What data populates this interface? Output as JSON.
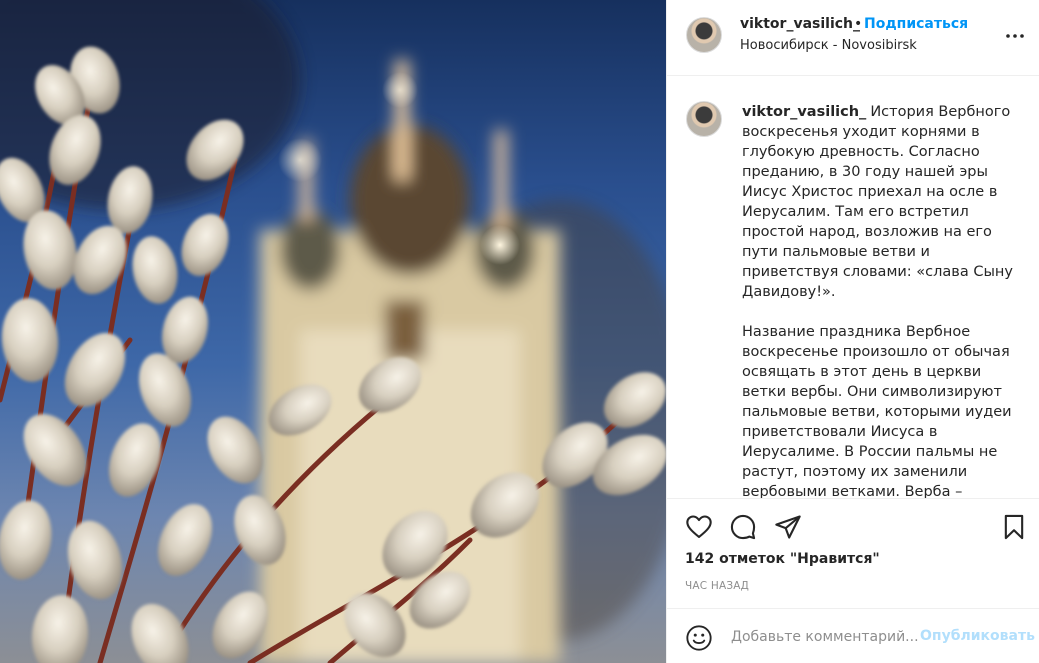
{
  "header": {
    "username": "viktor_vasilich_",
    "separator": "•",
    "follow_label": "Подписаться",
    "location": "Новосибирск - Novosibirsk"
  },
  "caption": {
    "username": "viktor_vasilich_",
    "text": "История Вербного воскресенья уходит корнями в глубокую древность. Согласно преданию, в 30 году нашей эры Иисус Христос приехал на осле в Иерусалим. Там его встретил простой народ, возложив на его пути пальмовые ветви и приветствуя словами: «слава Сыну Давидову!».\n\nНазвание праздника Вербное воскресенье произошло от обычая освящать в этот день в церкви ветки вербы. Они символизируют пальмовые ветви, которыми иудеи приветствовали Иисуса в Иерусалиме. В России пальмы не растут, поэтому их заменили вербовыми ветками. Верба –"
  },
  "likes": "142 отметок \"Нравится\"",
  "timestamp": "ЧАС НАЗАД",
  "comment": {
    "placeholder": "Добавьте комментарий...",
    "publish_label": "Опубликовать"
  },
  "icons": {
    "like": "heart-icon",
    "comment": "comment-bubble-icon",
    "share": "paper-plane-icon",
    "save": "bookmark-icon",
    "more": "more-dots-icon",
    "emoji": "emoji-smile-icon"
  },
  "colors": {
    "accent": "#0095f6",
    "publish_disabled": "#b2dffc",
    "muted": "#8e8e8e",
    "text": "#262626"
  }
}
